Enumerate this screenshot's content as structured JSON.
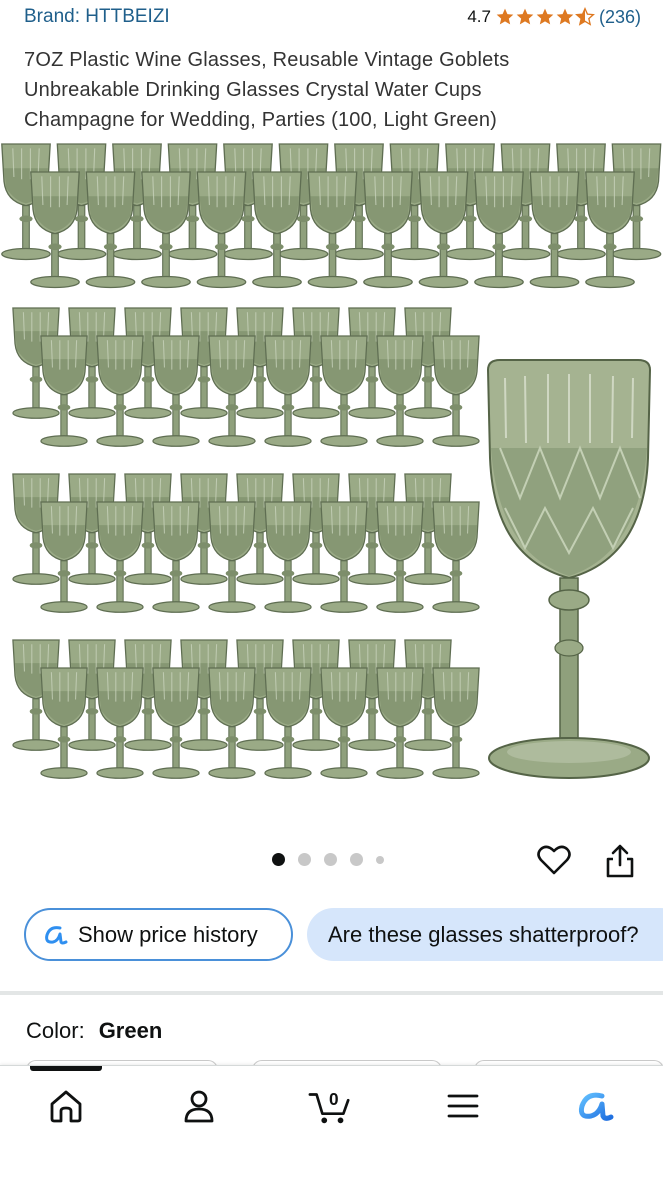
{
  "header": {
    "brand": "Brand: HTTBEIZI",
    "rating_value": "4.7",
    "rating_stars": 4.5,
    "rating_count": "(236)"
  },
  "product": {
    "title": "7OZ Plastic Wine Glasses, Reusable Vintage Goblets Unbreakable Drinking Glasses Crystal Water Cups Champagne for Wedding, Parties (100, Light Green)",
    "glass_color": "#8a9a78",
    "carousel": {
      "total": 5,
      "current": 1
    }
  },
  "actions": {
    "favorite_icon": "heart-icon",
    "share_icon": "share-icon"
  },
  "chips": {
    "price_history": "Show price history",
    "question": "Are these glasses shatterproof?"
  },
  "variation": {
    "label": "Color:",
    "value": "Green"
  },
  "nav": {
    "items": [
      "home-icon",
      "account-icon",
      "cart-icon",
      "menu-icon",
      "rufus-icon"
    ],
    "cart_count": "0",
    "active": 0
  },
  "colors": {
    "link": "#1f5f8b",
    "star": "#de7921",
    "chip_border": "#4a90d9",
    "chip_fill": "#d6e6fb",
    "rufus": "#2f8ff0"
  }
}
